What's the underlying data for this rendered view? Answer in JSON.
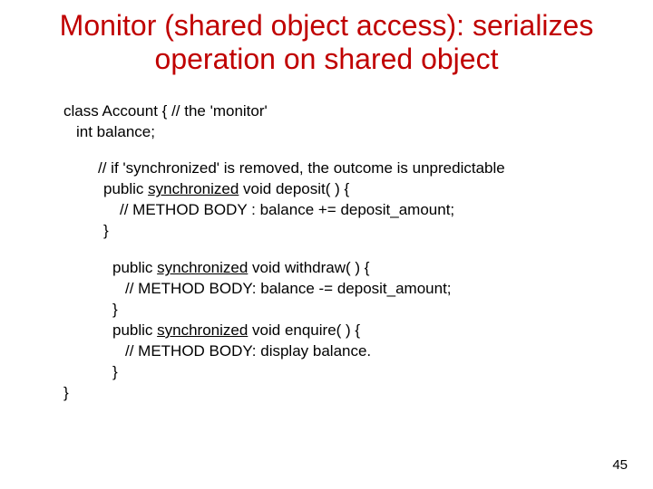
{
  "title": "Monitor (shared object access): serializes operation on shared object",
  "code": {
    "class_decl": "class Account {   // the 'monitor'",
    "field": "int balance;",
    "comment_sync": "// if 'synchronized' is removed, the outcome is unpredictable",
    "deposit_sig_pre": "public ",
    "deposit_sig_kw": "synchronized",
    "deposit_sig_post": " void deposit( ) {",
    "deposit_body": "// METHOD BODY : balance += deposit_amount;",
    "close_brace": "}",
    "withdraw_sig_pre": "public ",
    "withdraw_sig_kw": "synchronized",
    "withdraw_sig_post": " void withdraw( ) {",
    "withdraw_body": "// METHOD BODY: balance -= deposit_amount;",
    "enquire_sig_pre": "public ",
    "enquire_sig_kw": "synchronized",
    "enquire_sig_post": " void enquire( ) {",
    "enquire_body": "// METHOD BODY: display balance.",
    "class_close": "}"
  },
  "page_number": "45"
}
